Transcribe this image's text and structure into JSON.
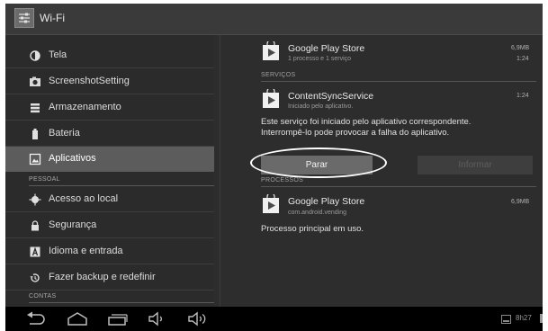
{
  "titlebar": {
    "title": "Wi-Fi",
    "icon": "settings-sliders-icon"
  },
  "left_menu": {
    "items_top": [
      {
        "label": "Tela",
        "icon": "brightness-icon"
      },
      {
        "label": "ScreenshotSetting",
        "icon": "camera-icon"
      },
      {
        "label": "Armazenamento",
        "icon": "storage-icon"
      },
      {
        "label": "Bateria",
        "icon": "battery-icon"
      },
      {
        "label": "Aplicativos",
        "icon": "apps-icon",
        "selected": true
      }
    ],
    "section_pessoal": "PESSOAL",
    "items_pessoal": [
      {
        "label": "Acesso ao local",
        "icon": "location-icon"
      },
      {
        "label": "Segurança",
        "icon": "lock-icon"
      },
      {
        "label": "Idioma e entrada",
        "icon": "keyboard-letter-icon"
      },
      {
        "label": "Fazer backup e redefinir",
        "icon": "restore-icon"
      }
    ],
    "section_contas": "CONTAS"
  },
  "detail": {
    "top_app": {
      "name": "Google Play Store",
      "sub": "1 processo e 1 serviço",
      "size": "6,9MB",
      "time": "1:24",
      "icon": "play-store-icon"
    },
    "section_servicos": "SERVIÇOS",
    "service": {
      "name": "ContentSyncService",
      "sub": "Iniciado pelo aplicativo.",
      "time": "1:24",
      "icon": "play-store-icon"
    },
    "message_line1": "Este serviço foi iniciado pelo aplicativo correspondente.",
    "message_line2": "Interrompê-lo pode provocar a falha do aplicativo.",
    "stop_button": "Parar",
    "report_button": "Informar",
    "section_processos": "PROCESSOS",
    "process": {
      "name": "Google Play Store",
      "sub": "com.android.vending",
      "size": "6,9MB",
      "icon": "play-store-icon"
    },
    "process_note": "Processo principal em uso."
  },
  "navbar": {
    "clock": "8h27",
    "buttons": [
      "back-icon",
      "home-icon",
      "recent-apps-icon",
      "volume-down-icon",
      "volume-up-icon"
    ]
  }
}
